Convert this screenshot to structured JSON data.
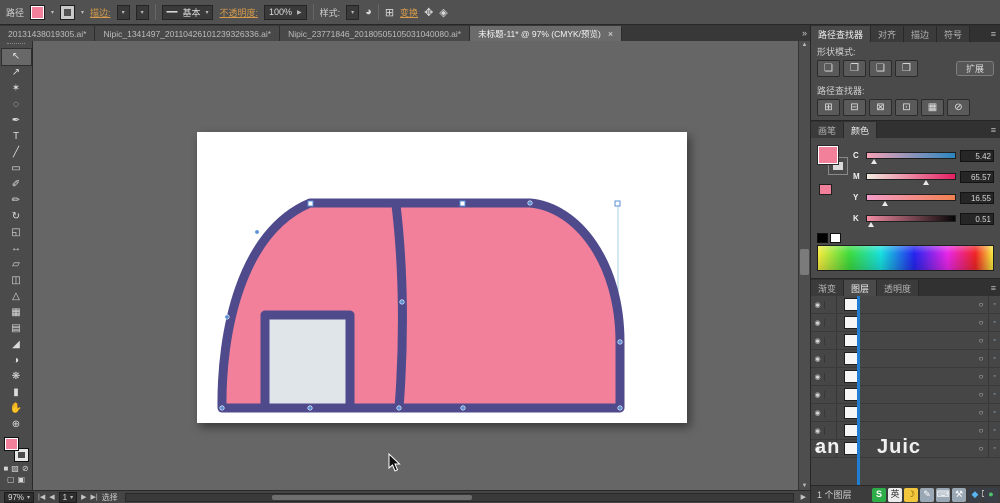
{
  "control_bar": {
    "object_label": "路径",
    "stroke_link": "描边:",
    "brush_style_value": "基本",
    "line_preview": "━━",
    "opacity_link": "不透明度:",
    "opacity_value": "100%",
    "style_label": "样式:",
    "transform_link": "变换"
  },
  "tab_bar": {
    "tabs": [
      {
        "label": "20131438019305.ai*"
      },
      {
        "label": "Nipic_1341497_20110426101239326336.ai*"
      },
      {
        "label": "Nipic_23771846_20180505105031040080.ai*"
      },
      {
        "label": "未标题-11* @ 97% (CMYK/预览)"
      }
    ],
    "close_glyph": "×",
    "overflow_glyph": "»"
  },
  "icons": {
    "dropdown": "▾",
    "eye": "◉",
    "dot": "◦",
    "menu": "≡",
    "up": "▲",
    "down": "▼",
    "left": "◀",
    "right": "▶",
    "recolor": "◕",
    "grid": "⊞",
    "arrange": "✥",
    "diamond": "◈",
    "mask": "◨",
    "new_layer": "⊞",
    "delete": "⌦"
  },
  "tools": [
    {
      "name": "selection-tool",
      "glyph": "↖"
    },
    {
      "name": "direct-selection-tool",
      "glyph": "↗"
    },
    {
      "name": "magic-wand-tool",
      "glyph": "✶"
    },
    {
      "name": "lasso-tool",
      "glyph": "◌"
    },
    {
      "name": "pen-tool",
      "glyph": "✒"
    },
    {
      "name": "type-tool",
      "glyph": "T"
    },
    {
      "name": "line-tool",
      "glyph": "╱"
    },
    {
      "name": "rectangle-tool",
      "glyph": "▭"
    },
    {
      "name": "paintbrush-tool",
      "glyph": "✐"
    },
    {
      "name": "pencil-tool",
      "glyph": "✏"
    },
    {
      "name": "rotate-tool",
      "glyph": "↻"
    },
    {
      "name": "scale-tool",
      "glyph": "◱"
    },
    {
      "name": "width-tool",
      "glyph": "↔"
    },
    {
      "name": "free-transform-tool",
      "glyph": "▱"
    },
    {
      "name": "shape-builder-tool",
      "glyph": "◫"
    },
    {
      "name": "perspective-grid-tool",
      "glyph": "△"
    },
    {
      "name": "mesh-tool",
      "glyph": "▦"
    },
    {
      "name": "gradient-tool",
      "glyph": "▤"
    },
    {
      "name": "eyedropper-tool",
      "glyph": "◢"
    },
    {
      "name": "blend-tool",
      "glyph": "◑"
    },
    {
      "name": "symbol-sprayer-tool",
      "glyph": "❋"
    },
    {
      "name": "column-graph-tool",
      "glyph": "▮"
    },
    {
      "name": "hand-tool",
      "glyph": "✋"
    },
    {
      "name": "zoom-tool",
      "glyph": "⊕"
    }
  ],
  "pathfinder_panel": {
    "tabs": [
      {
        "label": "路径查找器"
      },
      {
        "label": "对齐"
      },
      {
        "label": "描边"
      },
      {
        "label": "符号"
      }
    ],
    "shape_modes_label": "形状模式:",
    "shape_mode_buttons": [
      {
        "name": "unite",
        "glyph": "❏"
      },
      {
        "name": "minus-front",
        "glyph": "❐"
      },
      {
        "name": "intersect",
        "glyph": "❑"
      },
      {
        "name": "exclude",
        "glyph": "❒"
      }
    ],
    "expand_button": "扩展",
    "pathfinders_label": "路径查找器:",
    "pathfinder_buttons": [
      {
        "name": "divide",
        "glyph": "⊞"
      },
      {
        "name": "trim",
        "glyph": "⊟"
      },
      {
        "name": "merge",
        "glyph": "⊠"
      },
      {
        "name": "crop",
        "glyph": "⊡"
      },
      {
        "name": "outline",
        "glyph": "▦"
      },
      {
        "name": "minus-back",
        "glyph": "⊘"
      }
    ]
  },
  "color_panel": {
    "tabs": [
      {
        "label": "画笔"
      },
      {
        "label": "颜色"
      }
    ],
    "sliders": [
      {
        "label": "C",
        "value": "5.42"
      },
      {
        "label": "M",
        "value": "65.57"
      },
      {
        "label": "Y",
        "value": "16.55"
      },
      {
        "label": "K",
        "value": "0.51"
      }
    ]
  },
  "layers_panel": {
    "tabs": [
      {
        "label": "渐变"
      },
      {
        "label": "图层"
      },
      {
        "label": "透明度"
      }
    ],
    "rows": [
      {
        "target": "○"
      },
      {
        "target": "○"
      },
      {
        "target": "○"
      },
      {
        "target": "○"
      },
      {
        "target": "○"
      },
      {
        "target": "○"
      },
      {
        "target": "○"
      },
      {
        "target": "○"
      },
      {
        "target": "○"
      }
    ],
    "count_label": "1 个图层"
  },
  "status_bar": {
    "zoom": "97%",
    "first": "|◀",
    "prev": "◀",
    "next": "▶",
    "last": "▶|",
    "artboard": "1",
    "tool_label": "选择"
  },
  "taskbar": {
    "items": [
      {
        "name": "sogou-s-icon",
        "glyph": "S"
      },
      {
        "name": "input-mode-icon",
        "glyph": "英"
      },
      {
        "name": "moon-icon",
        "glyph": "☽"
      },
      {
        "name": "handwriting-pen-icon",
        "glyph": "✎"
      },
      {
        "name": "keyboard-icon",
        "glyph": "⌨"
      },
      {
        "name": "toolbox-icon",
        "glyph": "⚒"
      },
      {
        "name": "tray-icon-blue",
        "glyph": "◆"
      },
      {
        "name": "tray-icon-green",
        "glyph": "●"
      }
    ]
  },
  "watermark": {
    "text_left": "an",
    "text_right": "Juic"
  },
  "canvas": {
    "shape_fill": "#F2809B",
    "shape_stroke": "#4E4A8C",
    "door_fill": "#E0E5EA",
    "selection_guide": "#A7CFE6"
  }
}
